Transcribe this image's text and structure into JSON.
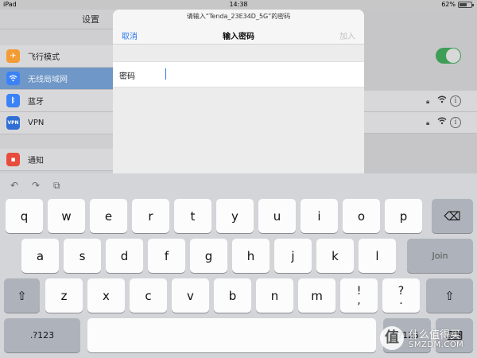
{
  "status_bar": {
    "device": "iPad",
    "time": "14:38",
    "battery": "62%",
    "battery_level": 0.62
  },
  "settings": {
    "title": "设置",
    "items": [
      {
        "label": "飞行模式",
        "icon": "airplane-icon",
        "color": "#f39c33"
      },
      {
        "label": "无线局域网",
        "icon": "wifi-icon",
        "color": "#3b82f6"
      },
      {
        "label": "蓝牙",
        "icon": "bluetooth-icon",
        "color": "#3b82f6"
      },
      {
        "label": "VPN",
        "icon": "vpn-icon",
        "color": "#2f6fd6"
      },
      {
        "label": "通知",
        "icon": "notification-icon",
        "color": "#e74c3c"
      }
    ]
  },
  "modal": {
    "subtitle": "请输入“Tenda_23E34D_5G”的密码",
    "title": "输入密码",
    "cancel": "取消",
    "join": "加入",
    "password_label": "密码",
    "password_value": ""
  },
  "keyboard": {
    "row1": [
      "q",
      "w",
      "e",
      "r",
      "t",
      "y",
      "u",
      "i",
      "o",
      "p"
    ],
    "row2": [
      "a",
      "s",
      "d",
      "f",
      "g",
      "h",
      "j",
      "k",
      "l"
    ],
    "row3": [
      "z",
      "x",
      "c",
      "v",
      "b",
      "n",
      "m"
    ],
    "join": "Join",
    "numbers": ".?123",
    "numbers_right": ".?123",
    "punct1_top": "!",
    "punct1_bottom": ",",
    "punct2_top": "?",
    "punct2_bottom": "."
  },
  "watermark": {
    "logo": "值",
    "line1": "什么值得买",
    "line2": "SMZDM.COM"
  }
}
